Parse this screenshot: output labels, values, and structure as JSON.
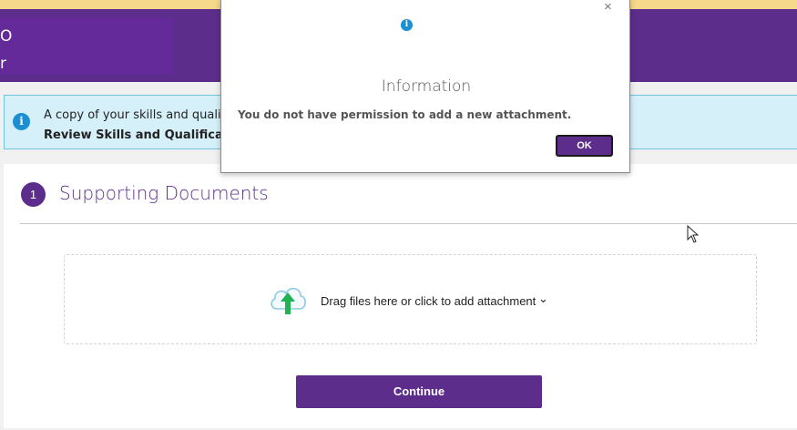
{
  "header": {
    "line1": "O",
    "line2": "r",
    "top_strip_color": "#f6d98a",
    "band_color": "#5c2d8a"
  },
  "banner": {
    "icon": "info-icon",
    "line1": "A copy of your skills and qualif",
    "line2": "Review Skills and Qualification",
    "bg_color": "#d5f0f9"
  },
  "section": {
    "step": "1",
    "title": "Supporting Documents"
  },
  "dropzone": {
    "icon": "cloud-upload-icon",
    "text": "Drag files here or click to add attachment",
    "chevron": "⌄"
  },
  "actions": {
    "continue_label": "Continue"
  },
  "dialog": {
    "close": "×",
    "icon": "info-icon",
    "title": "Information",
    "message": "You do not have permission to add a new attachment.",
    "ok_label": "OK"
  },
  "colors": {
    "accent": "#5c2d8a",
    "info": "#1b8fd1",
    "upload_arrow": "#21b253"
  }
}
